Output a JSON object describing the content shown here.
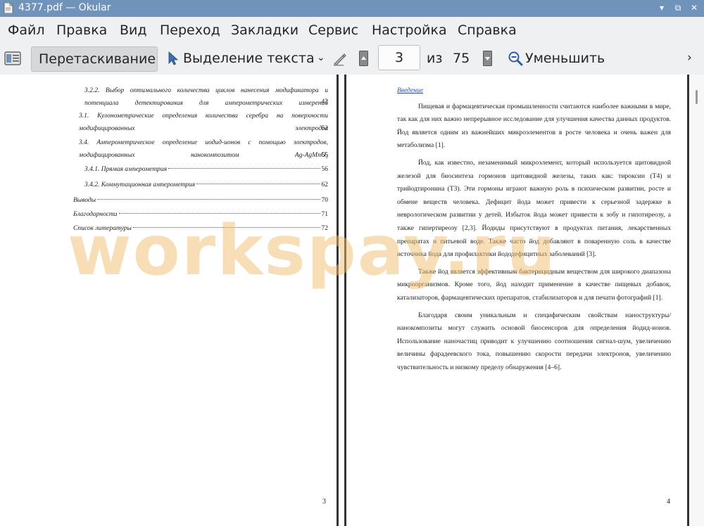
{
  "window": {
    "title": "4377.pdf  — Okular",
    "controls": [
      "minimize",
      "maximize",
      "close"
    ]
  },
  "menu": [
    "Файл",
    "Правка",
    "Вид",
    "Переход",
    "Закладки",
    "Сервис",
    "Настройка",
    "Справка"
  ],
  "toolbar": {
    "browse_label": "Перетаскивание",
    "select_label": "Выделение текста",
    "current_page": "3",
    "of_label": "из",
    "total_pages": "75",
    "zoom_out_label": "Уменьшить"
  },
  "left_page": {
    "toc": [
      {
        "text": "3.2.2. Выбор оптимального количества циклов нанесения модификатора и потенциала детектирования для амперометрических измерений",
        "page": "42"
      },
      {
        "text": "3.1. Кулонометрические определения количества серебра на поверхности модифицированных электродов",
        "page": "52"
      },
      {
        "text": "3.4. Амперометрическое определение иодид-ионов с помощью электродов, модифицированных нанокомпозитом Ag-AgMnO₂",
        "page": "55"
      },
      {
        "text": "3.4.1. Прямая амперометрия",
        "page": "56"
      },
      {
        "text": "3.4.2. Коммутационная амперометрия",
        "page": "62"
      },
      {
        "text": "Выводы",
        "page": "70"
      },
      {
        "text": "Благодарности",
        "page": "71"
      },
      {
        "text": "Список литературы",
        "page": "72"
      }
    ],
    "page_number": "3"
  },
  "right_page": {
    "heading": "Введение",
    "paragraphs": [
      "Пищевая и фармацевтическая промышленности считаются наиболее важными в мире, так как для них важно непрерывное исследование для улучшения качества данных продуктов. Йод является одним из важнейших микроэлементов в росте человека и очень важен для метаболизма [1].",
      "Йод, как известно, незаменимый микроэлемент, который используется щитовидной железой для биосинтеза гормонов щитовидной железы, таких как: тироксин (Т4) и трийодтиронина (Т3). Эти гормоны играют важную роль в психическом развитии, росте и обмене веществ человека. Дефицит йода может привести к серьезной задержке в неврологическом развитии у детей. Избыток йода может привести к зобу и гипотиреозу, а также гипертиреозу [2,3]. Йодиды присутствуют в продуктах питания, лекарственных препаратах и питьевой воде. Также часто йод добавляют в поваренную соль в качестве источника йода для профилактики йододефицитных заболеваний [3].",
      "Также йод является эффективным бактерицидным веществом для широкого диапазона микроорганизмов. Кроме того, йод находит применение в качестве пищевых добавок, катализаторов, фармацевтических препаратов, стабилизаторов и для печати фотографий [1].",
      "Благодаря своим уникальным и специфическим свойствам наноструктуры/нанокомпозиты могут служить основой биосенсоров для определения йодид-ионов. Использование наночастиц приводит к улучшению соотношения сигнал-шум, увеличению величины фарадеевского тока, повышению скорости передачи электронов, увеличению чувствительность и низкому пределу обнаружения [4–6]."
    ],
    "page_number": "4"
  },
  "watermark": "workspay.ru"
}
